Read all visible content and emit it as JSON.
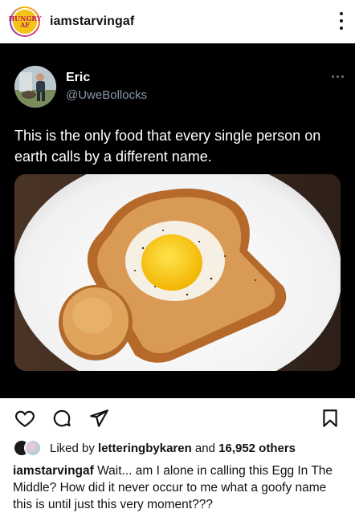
{
  "header": {
    "username": "iamstarvingaf",
    "avatar_logo_text": "HUNGRY AF"
  },
  "tweet": {
    "name": "Eric",
    "handle": "@UweBollocks",
    "text": "This is the only food that every single person on earth calls by a different name."
  },
  "likes": {
    "prefix": "Liked by ",
    "user": "letteringbykaren",
    "middle": " and ",
    "count": "16,952 others"
  },
  "caption": {
    "username": "iamstarvingaf",
    "text": " Wait... am I alone in calling this Egg In The Middle? How did it never occur to me what a goofy name this is until just this very moment???"
  },
  "icons": {
    "like": "heart-icon",
    "comment": "comment-icon",
    "share": "send-icon",
    "save": "bookmark-icon"
  }
}
